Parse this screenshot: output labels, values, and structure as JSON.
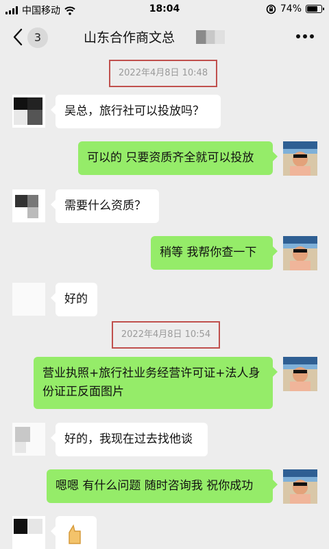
{
  "status_bar": {
    "carrier": "中国移动",
    "time": "18:04",
    "battery": "74%",
    "battery_level": 0.74
  },
  "header": {
    "back_count": "3",
    "title": "山东合作商文总"
  },
  "timestamps": [
    "2022年4月8日 10:48",
    "2022年4月8日 10:54"
  ],
  "messages": [
    {
      "side": "in",
      "text": "吴总，旅行社可以投放吗？"
    },
    {
      "side": "out",
      "text": "可以的 只要资质齐全就可以投放"
    },
    {
      "side": "in",
      "text": "需要什么资质？"
    },
    {
      "side": "out",
      "text": "稍等 我帮你查一下"
    },
    {
      "side": "in",
      "text": "好的"
    },
    {
      "side": "out",
      "text": "营业执照+旅行社业务经营许可证+法人身份证正反面图片"
    },
    {
      "side": "in",
      "text": "好的，我现在过去找他谈"
    },
    {
      "side": "out",
      "text": "嗯嗯 有什么问题 随时咨询我 祝你成功"
    }
  ],
  "icons": [
    "back-arrow-icon",
    "more-dots-icon",
    "wifi-icon",
    "rotation-lock-icon",
    "battery-icon",
    "signal-icon"
  ]
}
